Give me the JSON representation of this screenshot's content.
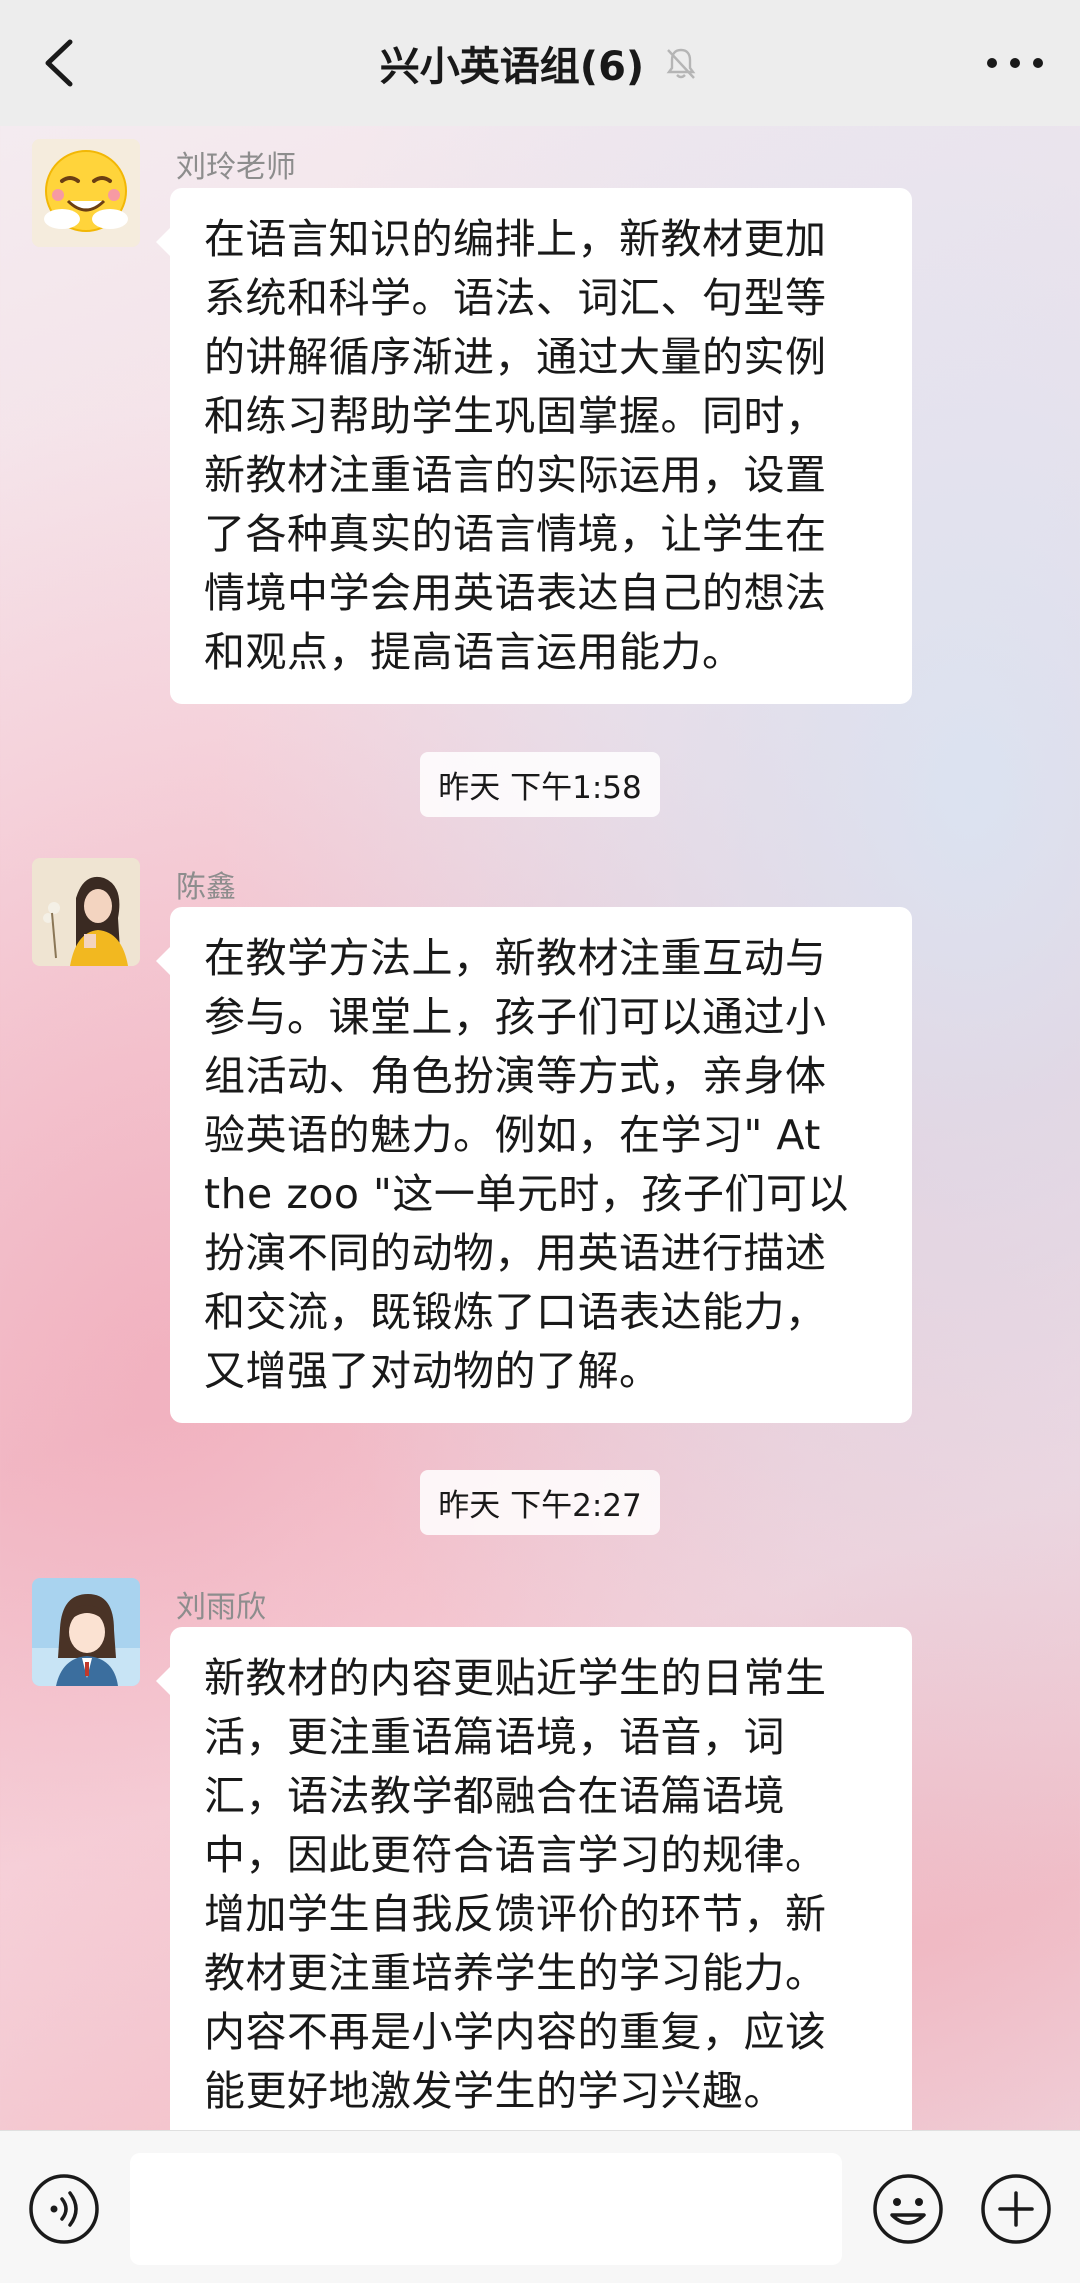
{
  "header": {
    "title": "兴小英语组(6)",
    "muted": true
  },
  "messages": [
    {
      "sender": "刘玲老师",
      "avatar": "emoji-sun-avatar",
      "lines": [
        "在语言知识的编排上，新教材更加",
        "系统和科学。语法、词汇、句型等",
        "的讲解循序渐进，通过大量的实例",
        "和练习帮助学生巩固掌握。同时，",
        "新教材注重语言的实际运用，设置",
        "了各种真实的语言情境，让学生在",
        "情境中学会用英语表达自己的想法",
        "和观点，提高语言运用能力。"
      ]
    },
    {
      "time": "昨天 下午1:58",
      "sender": "陈鑫",
      "avatar": "girl-yellow-avatar",
      "lines": [
        "在教学方法上，新教材注重互动与",
        "参与。课堂上，孩子们可以通过小",
        "组活动、角色扮演等方式，亲身体",
        "验英语的魅力。例如，在学习\" At",
        "the zoo \"这一单元时，孩子们可以",
        "扮演不同的动物，用英语进行描述",
        "和交流，既锻炼了口语表达能力，",
        "又增强了对动物的了解。"
      ]
    },
    {
      "time": "昨天 下午2:27",
      "sender": "刘雨欣",
      "avatar": "anime-girl-avatar",
      "lines": [
        "新教材的内容更贴近学生的日常生",
        "活，更注重语篇语境，语音，词",
        "汇，语法教学都融合在语篇语境",
        "中，因此更符合语言学习的规律。",
        "增加学生自我反馈评价的环节，新",
        "教材更注重培养学生的学习能力。",
        "内容不再是小学内容的重复，应该",
        "能更好地激发学生的学习兴趣。"
      ]
    }
  ],
  "input": {
    "value": "",
    "placeholder": ""
  },
  "icons": {
    "back": "chevron-left-icon",
    "mute": "bell-off-icon",
    "more": "more-dots-icon",
    "voice": "voice-icon",
    "emoji": "emoji-icon",
    "plus": "plus-icon"
  },
  "colors": {
    "bubble": "#ffffff",
    "header": "#ededed",
    "text": "#191919",
    "sender": "#8d8d8d"
  }
}
